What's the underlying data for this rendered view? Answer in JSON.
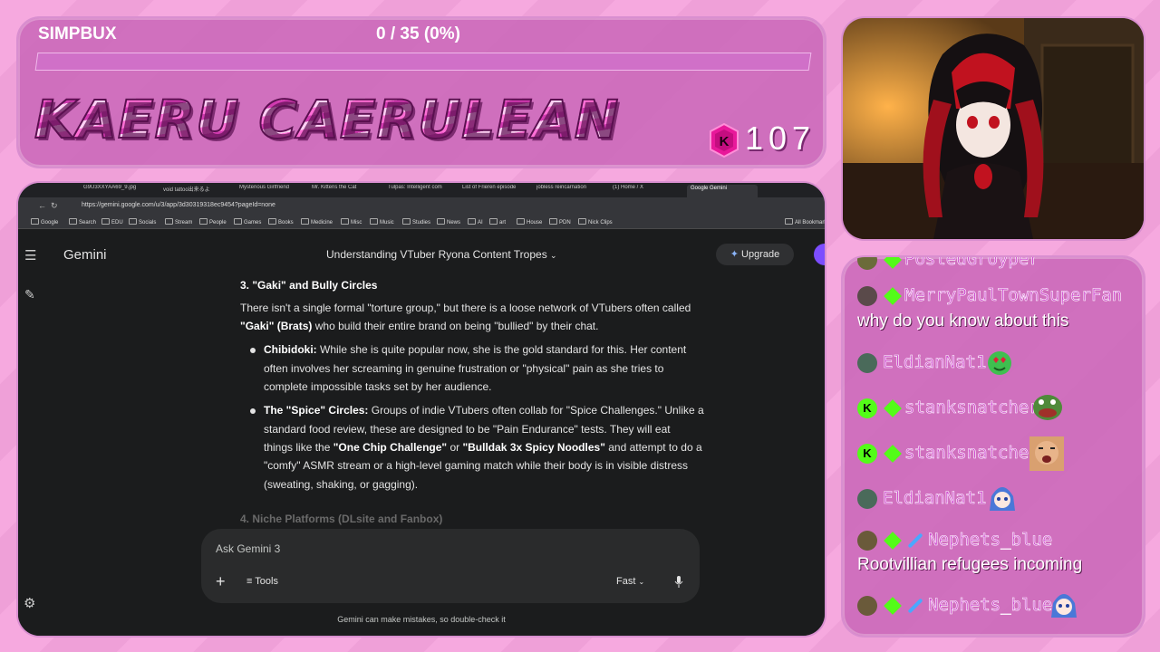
{
  "overlay": {
    "simpbux_label": "SIMPBUX",
    "simpbux_progress": "0 / 35 (0%)",
    "simpbux_fraction": 0.0,
    "channel_title": "KAERU CAERULEAN",
    "coin_letter": "K",
    "coin_count": "107"
  },
  "browser": {
    "tabs": [
      "G9U3XXYAA69_9.jpg",
      "void tattoo出来るよ",
      "Mysterious Girlfriend",
      "Mr. Kittens the Cat",
      "Tulpas: Intelligent com",
      "List of Frieren episode",
      "jobless reincarnation",
      "(1) Home / X",
      "Google Gemini"
    ],
    "url": "https://gemini.google.com/u/3/app/3d30319318ec9454?pageId=none",
    "bookmarks": [
      "Google",
      "Search",
      "EDU",
      "Socials",
      "Stream",
      "People",
      "Games",
      "Books",
      "Medicine",
      "Misc",
      "Music",
      "Studies",
      "News",
      "AI",
      "art",
      "House",
      "PDN",
      "Nick Clips",
      "All Bookmarks"
    ]
  },
  "gemini": {
    "app_name": "Gemini",
    "chat_title": "Understanding VTuber Ryona Content Tropes",
    "upgrade_label": "Upgrade",
    "section_heading": "3. \"Gaki\" and Bully Circles",
    "intro_1": "There isn't a single formal \"torture group,\" but there is a loose network of VTubers often called",
    "intro_bold": "\"Gaki\" (Brats)",
    "intro_2": " who build their entire brand on being \"bullied\" by their chat.",
    "b1_title": "Chibidoki:",
    "b1_l1": " While she is quite popular now, she is the gold standard for this. Her content",
    "b1_l2": "often involves her screaming in genuine frustration or \"physical\" pain as she tries to",
    "b1_l3": "complete impossible tasks set by her audience.",
    "b2_title": "The \"Spice\" Circles:",
    "b2_l1": " Groups of indie VTubers often collab for \"Spice Challenges.\" Unlike a",
    "b2_l2": "standard food review, these are designed to be \"Pain Endurance\" tests. They will eat",
    "b2_l3a": "things like the ",
    "b2_l3b": "\"One Chip Challenge\"",
    "b2_l3c": " or ",
    "b2_l3d": "\"Bulldak 3x Spicy Noodles\"",
    "b2_l3e": " and attempt to do a",
    "b2_l4": "\"comfy\" ASMR stream or a high-level gaming match while their body is in visible distress",
    "b2_l5": "(sweating, shaking, or gagging).",
    "next_heading": "4. Niche Platforms (DLsite and Fanbox)",
    "input_placeholder": "Ask Gemini 3",
    "tools_label": "Tools",
    "mode_label": "Fast",
    "disclaimer": "Gemini can make mistakes, so double-check it"
  },
  "chat": {
    "partial_name": "PostedGroyper",
    "messages": [
      {
        "user": "MerryPaulTownSuperFan",
        "text": "why do you know about this"
      },
      {
        "user": "EldianNat1",
        "text": ""
      },
      {
        "user": "stanksnatcher",
        "text": ""
      },
      {
        "user": "stanksnatcher",
        "text": ""
      },
      {
        "user": "EldianNat1",
        "text": ""
      },
      {
        "user": "Nephets_blue",
        "text": "Rootvillian refugees incoming"
      },
      {
        "user": "Nephets_blue",
        "text": ""
      }
    ],
    "badge_letter": "K"
  },
  "colors": {
    "panel": "#c966b9",
    "kick_green": "#53fc18",
    "username": "#d04cd0",
    "gemini_bg": "#1b1c1d"
  }
}
